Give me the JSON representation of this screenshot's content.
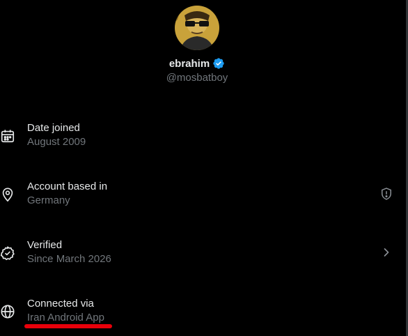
{
  "profile": {
    "name": "ebrahim",
    "handle": "@mosbatboy",
    "verified_icon": "verified-badge-icon",
    "avatar": "avatar"
  },
  "details": [
    {
      "label": "Date joined",
      "value": "August 2009",
      "icon": "calendar-icon"
    },
    {
      "label": "Account based in",
      "value": "Germany",
      "icon": "location-pin-icon",
      "trailing_icon": "shield-alert-icon"
    },
    {
      "label": "Verified",
      "value": "Since March 2026",
      "icon": "verified-check-icon",
      "trailing_icon": "chevron-right-icon"
    },
    {
      "label": "Connected via",
      "value": "Iran Android App",
      "icon": "globe-icon"
    }
  ],
  "colors": {
    "background": "#000000",
    "primary_text": "#e7e9ea",
    "secondary_text": "#71767b",
    "verified_blue": "#1d9bf0",
    "highlight_underline": "#e8000a"
  }
}
